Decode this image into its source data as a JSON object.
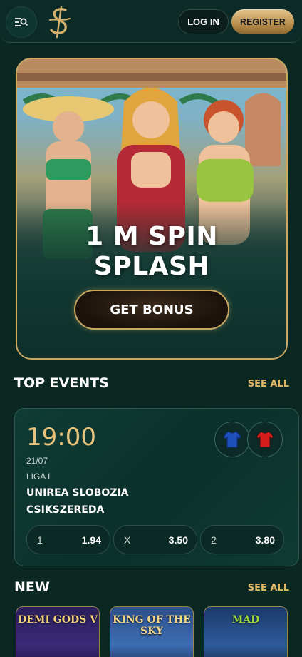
{
  "header": {
    "login_label": "LOG IN",
    "register_label": "REGISTER",
    "menu_icon": "search-menu-icon",
    "logo_icon": "dollar-script-logo"
  },
  "banner": {
    "title_line1": "1 M SPIN",
    "title_line2": "SPLASH",
    "cta_label": "GET BONUS"
  },
  "top_events": {
    "title": "TOP EVENTS",
    "see_all": "SEE ALL",
    "event": {
      "time": "19:00",
      "date": "21/07",
      "league": "LIGA I",
      "home_team": "UNIREA SLOBOZIA",
      "away_team": "CSIKSZEREDA",
      "home_jersey_color": "#1f4fb8",
      "away_jersey_color": "#d71e1e",
      "odds": [
        {
          "label": "1",
          "value": "1.94"
        },
        {
          "label": "X",
          "value": "3.50"
        },
        {
          "label": "2",
          "value": "3.80"
        }
      ]
    }
  },
  "new_games": {
    "title": "NEW",
    "see_all": "SEE ALL",
    "games": [
      {
        "name": "DEMI GODS V"
      },
      {
        "name": "KING OF THE SKY"
      },
      {
        "name": "MAD"
      }
    ]
  },
  "colors": {
    "background": "#0a2722",
    "accent_gold": "#e0b868",
    "card": "#0f3c35"
  }
}
